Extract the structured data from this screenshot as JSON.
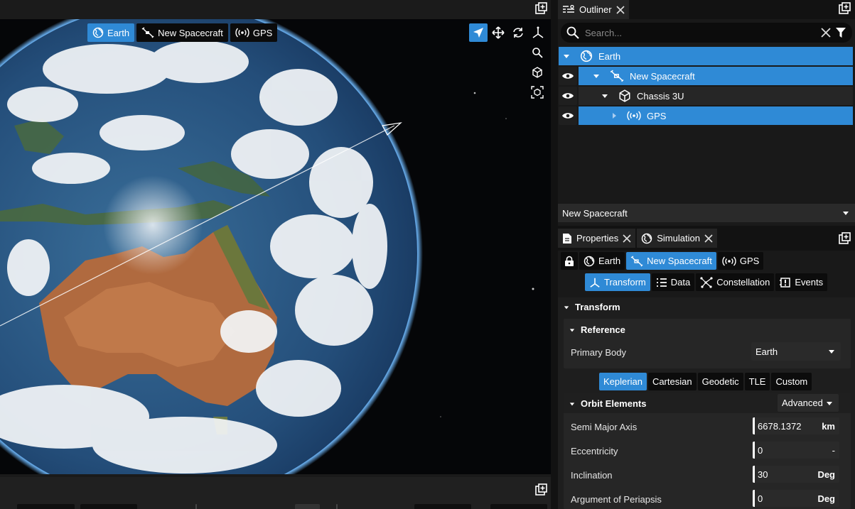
{
  "viewport": {
    "chips": [
      {
        "label": "Earth",
        "icon": "globe-icon",
        "active": true
      },
      {
        "label": "New Spacecraft",
        "icon": "satellite-icon",
        "active": false
      },
      {
        "label": "GPS",
        "icon": "broadcast-icon",
        "active": false
      }
    ],
    "tools": [
      "navigate-icon",
      "move-icon",
      "rotate-icon",
      "axes-icon"
    ],
    "side_tools": [
      "zoom-icon",
      "cube-icon",
      "focus-cube-icon"
    ]
  },
  "outliner": {
    "tab_label": "Outliner",
    "search_placeholder": "Search...",
    "tree": [
      {
        "label": "Earth",
        "icon": "globe-icon"
      },
      {
        "label": "New Spacecraft",
        "icon": "satellite-icon"
      },
      {
        "label": "Chassis 3U",
        "icon": "cube-icon"
      },
      {
        "label": "GPS",
        "icon": "broadcast-icon"
      }
    ],
    "footer_selection": "New Spacecraft"
  },
  "properties": {
    "tabs": [
      "Properties",
      "Simulation"
    ],
    "breadcrumb": [
      "Earth",
      "New Spacecraft",
      "GPS"
    ],
    "subtabs": [
      "Transform",
      "Data",
      "Constellation",
      "Events"
    ],
    "transform_title": "Transform",
    "reference_title": "Reference",
    "primary_body_label": "Primary Body",
    "primary_body_value": "Earth",
    "modes": [
      "Keplerian",
      "Cartesian",
      "Geodetic",
      "TLE",
      "Custom"
    ],
    "orbit_title": "Orbit Elements",
    "orbit_mode": "Advanced",
    "fields": [
      {
        "label": "Semi Major Axis",
        "value": "6678.1372",
        "unit": "km"
      },
      {
        "label": "Eccentricity",
        "value": "0",
        "unit": "-"
      },
      {
        "label": "Inclination",
        "value": "30",
        "unit": "Deg"
      },
      {
        "label": "Argument of Periapsis",
        "value": "0",
        "unit": "Deg"
      }
    ]
  },
  "colors": {
    "accent": "#2f8ad6",
    "panel": "#191919",
    "space": "#050608"
  }
}
